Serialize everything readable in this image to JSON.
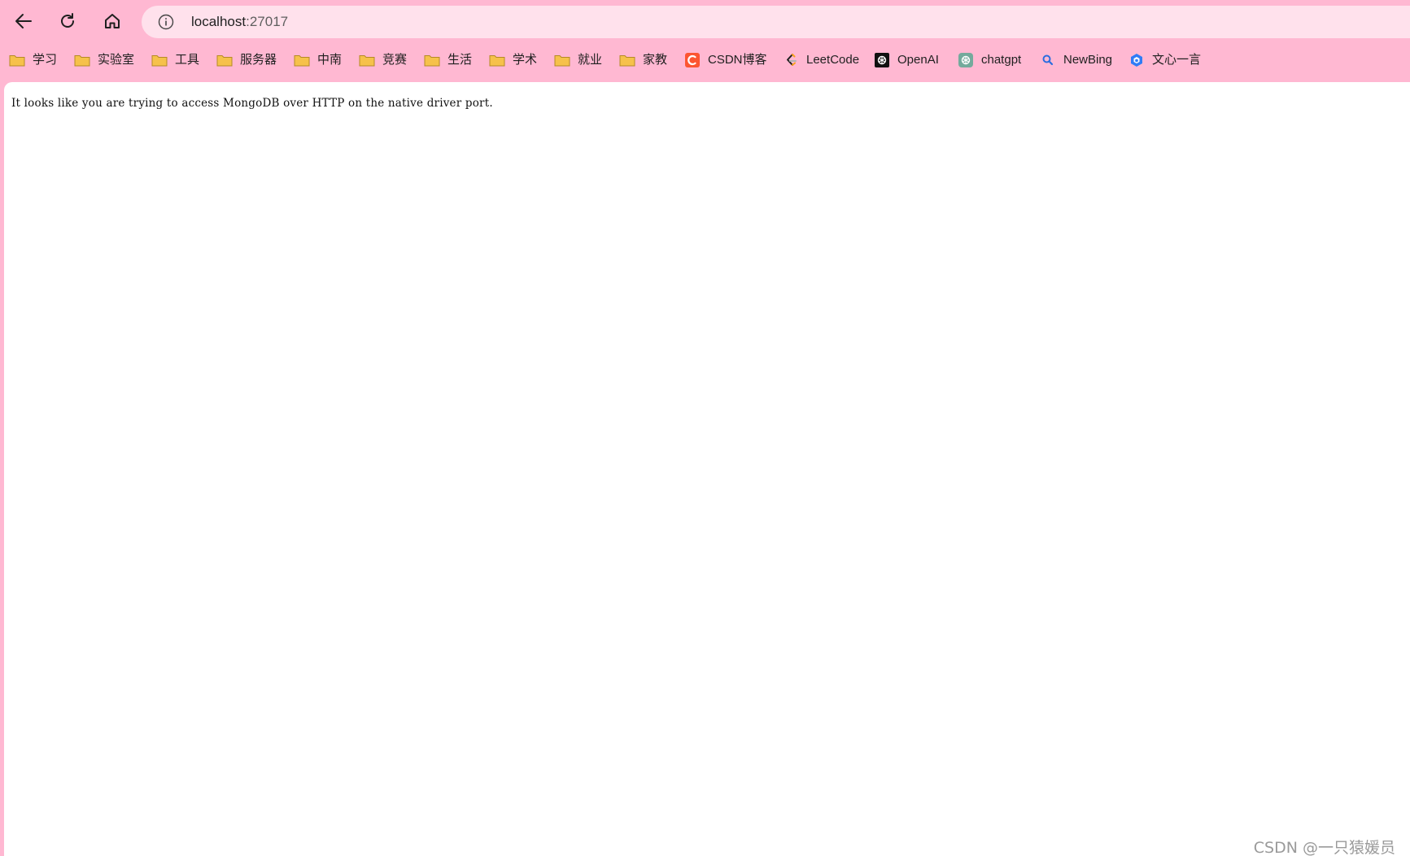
{
  "toolbar": {
    "back_icon": "arrow-left-icon",
    "reload_icon": "reload-icon",
    "home_icon": "home-icon"
  },
  "address_bar": {
    "host": "localhost",
    "port": ":27017",
    "site_info_icon": "info-circle-icon"
  },
  "bookmarks": [
    {
      "label": "学习",
      "icon": "folder-icon"
    },
    {
      "label": "实验室",
      "icon": "folder-icon"
    },
    {
      "label": "工具",
      "icon": "folder-icon"
    },
    {
      "label": "服务器",
      "icon": "folder-icon"
    },
    {
      "label": "中南",
      "icon": "folder-icon"
    },
    {
      "label": "竞赛",
      "icon": "folder-icon"
    },
    {
      "label": "生活",
      "icon": "folder-icon"
    },
    {
      "label": "学术",
      "icon": "folder-icon"
    },
    {
      "label": "就业",
      "icon": "folder-icon"
    },
    {
      "label": "家教",
      "icon": "folder-icon"
    },
    {
      "label": "CSDN博客",
      "icon": "csdn-icon"
    },
    {
      "label": "LeetCode",
      "icon": "leetcode-icon"
    },
    {
      "label": "OpenAI",
      "icon": "openai-icon"
    },
    {
      "label": "chatgpt",
      "icon": "chatgpt-icon"
    },
    {
      "label": "NewBing",
      "icon": "search-icon"
    },
    {
      "label": "文心一言",
      "icon": "wenxin-icon"
    }
  ],
  "page": {
    "message": "It looks like you are trying to access MongoDB over HTTP on the native driver port."
  },
  "watermark": "CSDN @一只猿媛员",
  "colors": {
    "chrome_background": "#ffb8d2",
    "address_bar": "#ffe1ec",
    "folder": "#f6c14b",
    "csdn": "#fc5531"
  }
}
